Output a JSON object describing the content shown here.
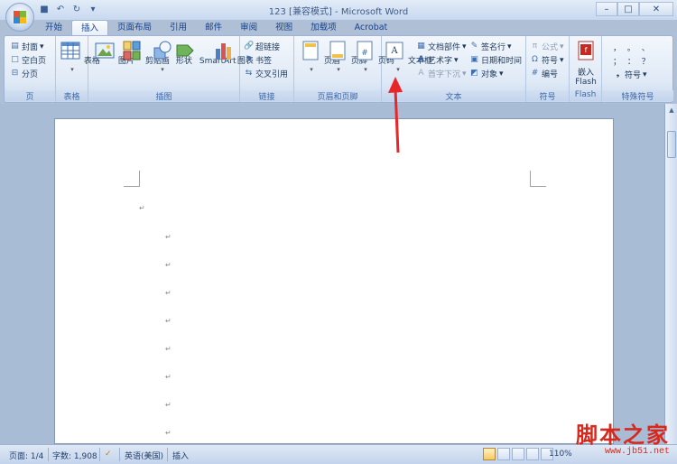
{
  "window": {
    "title": "123 [兼容模式] - Microsoft Word"
  },
  "tabs": [
    "开始",
    "插入",
    "页面布局",
    "引用",
    "邮件",
    "审阅",
    "视图",
    "加载项",
    "Acrobat"
  ],
  "active_tab": "插入",
  "ribbon": {
    "pages": {
      "label": "页",
      "cover": "封面",
      "blank": "空白页",
      "page_break": "分页"
    },
    "tables": {
      "label": "表格",
      "table": "表格"
    },
    "illustrations": {
      "label": "插图",
      "picture": "图片",
      "clipart": "剪贴画",
      "shapes": "形状",
      "smartart": "SmartArt",
      "chart": "图表"
    },
    "links": {
      "label": "链接",
      "hyperlink": "超链接",
      "bookmark": "书签",
      "crossref": "交叉引用"
    },
    "header_footer": {
      "label": "页眉和页脚",
      "header": "页眉",
      "footer": "页脚",
      "page_number": "页码"
    },
    "text": {
      "label": "文本",
      "textbox": "文本框",
      "quickparts": "文档部件",
      "wordart": "艺术字",
      "dropcap": "首字下沉",
      "signature": "签名行",
      "datetime": "日期和时间",
      "object": "对象"
    },
    "symbols": {
      "label": "符号",
      "equation": "公式",
      "symbol": "符号",
      "numbering": "编号"
    },
    "flash": {
      "label": "Flash",
      "embed_line1": "嵌入",
      "embed_line2": "Flash"
    },
    "special": {
      "label": "特殊符号",
      "symbol": "符号",
      "row1": "，  。  、",
      "row2": "；  ：  ？"
    }
  },
  "document": {
    "para_mark": "↵"
  },
  "status": {
    "page": "页面: 1/4",
    "words": "字数: 1,908",
    "language": "英语(美国)",
    "mode": "插入",
    "zoom": "110%"
  },
  "watermark": {
    "main": "脚本之家",
    "sub": "www.jb51.net"
  },
  "colors": {
    "arrow": "#e8262a",
    "ribbon_bg": "#dfe9f6"
  }
}
